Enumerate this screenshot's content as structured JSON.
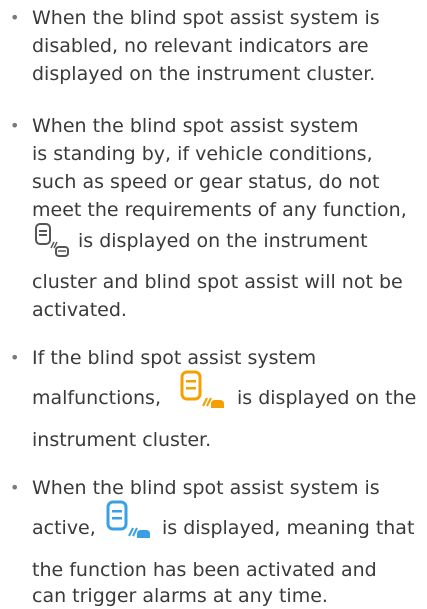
{
  "bullets": [
    {
      "lines": [
        "When the blind spot assist system is",
        "disabled, no relevant indicators are",
        "displayed on the instrument cluster."
      ]
    },
    {
      "lines": [
        "When the blind spot assist system",
        "is standing by, if vehicle conditions,",
        "such as speed or gear status, do not",
        "meet the requirements of any function,",
        "is displayed on the instrument",
        "cluster and blind spot assist will not be",
        "activated."
      ],
      "icon": "blind-spot-standby-icon",
      "icon_color": "#555555"
    },
    {
      "lines": [
        "If the blind spot assist system",
        "malfunctions,",
        "is displayed on the",
        "instrument cluster."
      ],
      "icon": "blind-spot-malfunction-icon",
      "icon_color": "#f5a000"
    },
    {
      "lines": [
        "When the blind spot assist system is",
        "active,",
        "is displayed, meaning that",
        "the function has been activated and",
        "can trigger alarms at any time."
      ],
      "icon": "blind-spot-active-icon",
      "icon_color": "#3aa0e6"
    }
  ],
  "bullet_glyph": "•"
}
